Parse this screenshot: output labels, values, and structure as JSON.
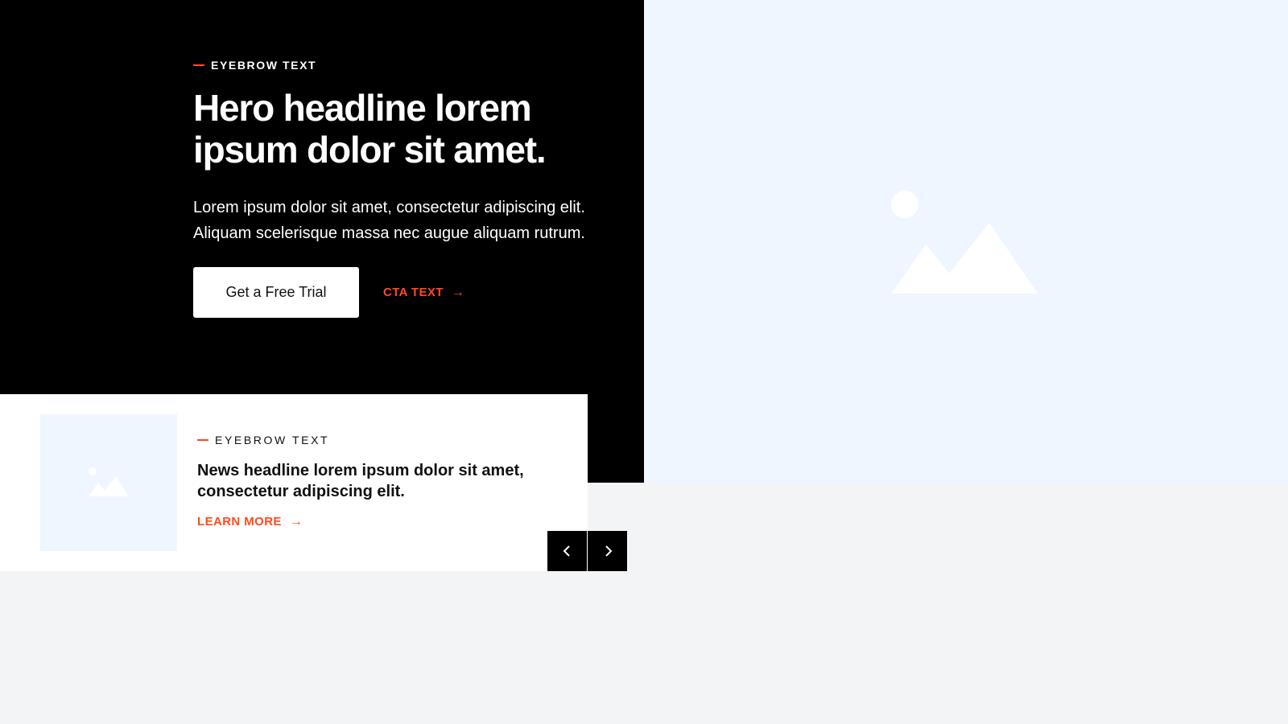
{
  "hero": {
    "eyebrow": "EYEBROW TEXT",
    "headline": "Hero headline lorem ipsum dolor sit amet.",
    "body": "Lorem ipsum dolor sit amet, consectetur adipiscing elit. Aliquam scelerisque massa nec augue aliquam rutrum.",
    "primary_button": "Get a Free Trial",
    "cta_link": "CTA TEXT",
    "image_icon": "image-placeholder-icon"
  },
  "news": {
    "eyebrow": "EYEBROW TEXT",
    "headline": "News headline lorem ipsum dolor sit amet, consectetur adipiscing elit.",
    "link": "LEARN MORE",
    "thumb_icon": "image-placeholder-icon"
  },
  "slider": {
    "prev_icon": "chevron-left-icon",
    "next_icon": "chevron-right-icon"
  },
  "colors": {
    "accent": "#ff4a1c",
    "dark": "#000000",
    "image_bg": "#eff6ff",
    "page_bg": "#f3f4f6"
  }
}
